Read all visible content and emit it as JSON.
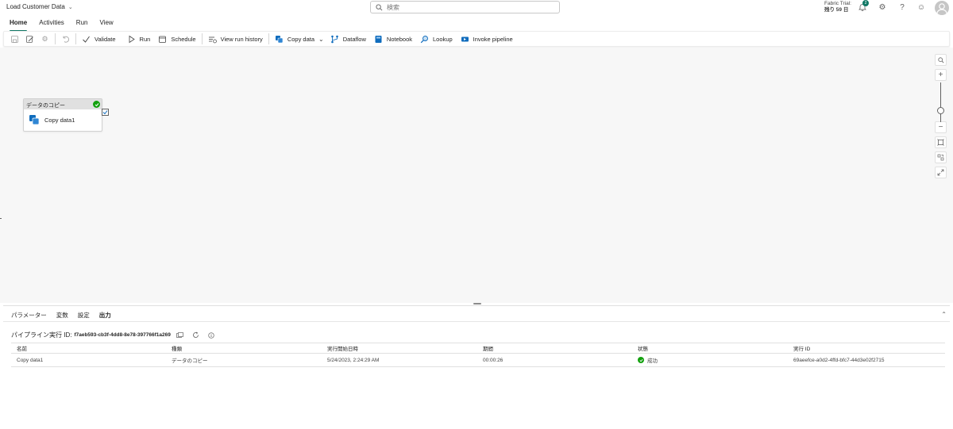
{
  "app": {
    "title": "Load Customer Data"
  },
  "search": {
    "placeholder": "検索"
  },
  "trial": {
    "line1": "Fabric Trial:",
    "line2": "残り 59 日"
  },
  "notifications": {
    "count": "2"
  },
  "tabs": [
    {
      "label": "Home"
    },
    {
      "label": "Activities"
    },
    {
      "label": "Run"
    },
    {
      "label": "View"
    }
  ],
  "toolbar": {
    "validate": "Validate",
    "run": "Run",
    "schedule": "Schedule",
    "view_run_history": "View run history",
    "copy_data": "Copy data",
    "dataflow": "Dataflow",
    "notebook": "Notebook",
    "lookup": "Lookup",
    "invoke_pipeline": "Invoke pipeline"
  },
  "activity": {
    "type": "データのコピー",
    "name": "Copy data1"
  },
  "panel": {
    "tabs": [
      {
        "label": "パラメーター"
      },
      {
        "label": "変数"
      },
      {
        "label": "設定"
      },
      {
        "label": "出力"
      }
    ],
    "run_id_label": "パイプライン実行 ID:",
    "run_id_value": "f7aeb593-cb3f-4dd8-8e78-397766f1a269",
    "columns": [
      "名前",
      "種類",
      "実行開始日時",
      "期間",
      "状態",
      "実行 ID"
    ],
    "rows": [
      {
        "name": "Copy data1",
        "type": "データのコピー",
        "start": "5/24/2023, 2:24:29 AM",
        "duration": "00:00:26",
        "status": "成功",
        "run_id": "69aeefce-a0d2-4ffd-bfc7-44d3e02f2715"
      }
    ]
  },
  "colors": {
    "accent": "#117865",
    "success": "#13a10e",
    "canvas": "#f7f7f7"
  }
}
